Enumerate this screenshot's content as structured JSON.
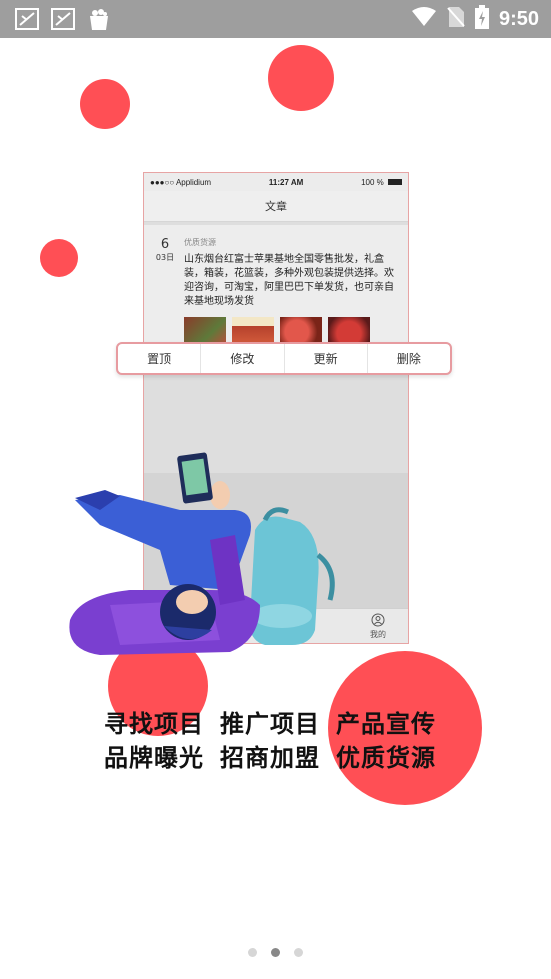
{
  "status_bar": {
    "time": "9:50",
    "notification_icons": [
      "notification-icon",
      "notification-icon",
      "shopping-bag-icon"
    ],
    "system_icons": [
      "wifi-icon",
      "no-sim-icon",
      "battery-charging-icon"
    ]
  },
  "phone_mockup": {
    "ios_status": {
      "carrier": "●●●○○ Applidium",
      "time": "11:27 AM",
      "battery": "100 %"
    },
    "nav_title": "文章",
    "article": {
      "day": "6",
      "month": "03日",
      "tag": "优质货源",
      "text": "山东烟台红富士苹果基地全国零售批发，礼盒装，箱装，花篮装，多种外观包装提供选择。欢迎咨询，可淘宝，阿里巴巴下单发货，也可亲自来基地现场发货"
    },
    "tab_mine": "我的"
  },
  "action_bar": {
    "items": [
      "置顶",
      "修改",
      "更新",
      "删除"
    ]
  },
  "slogan": {
    "row1": [
      "寻找项目",
      "推广项目",
      "产品宣传"
    ],
    "row2": [
      "品牌曝光",
      "招商加盟",
      "优质货源"
    ]
  },
  "pager": {
    "count": 3,
    "active_index": 1
  },
  "colors": {
    "accent_red": "#ff4f55",
    "status_bar": "#9e9e9e",
    "action_border": "#e79ba0"
  }
}
